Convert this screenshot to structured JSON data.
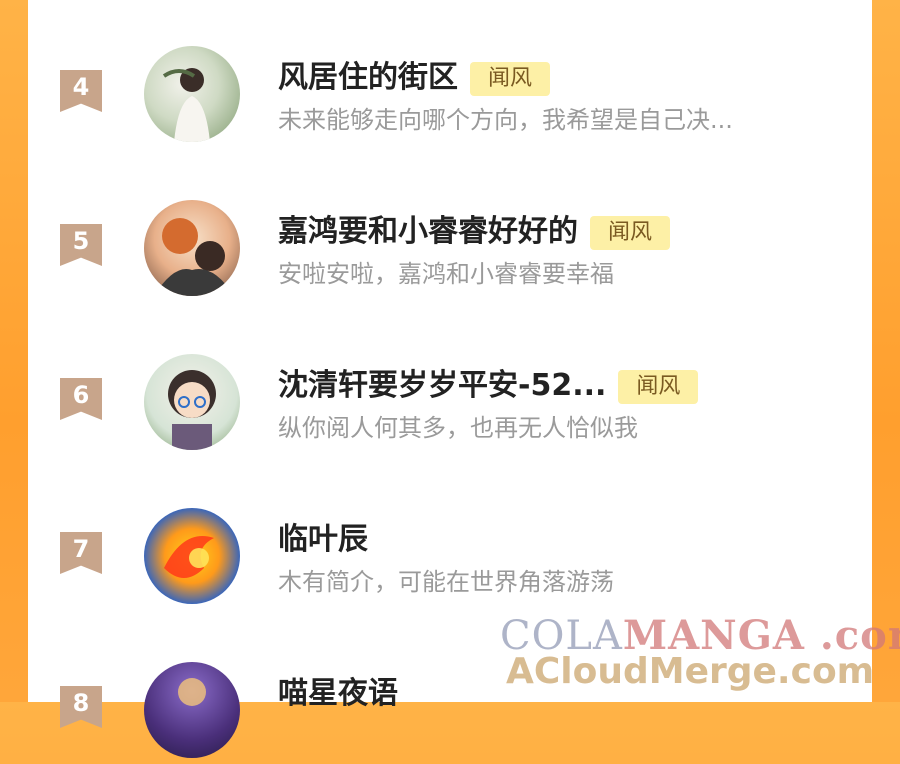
{
  "list": [
    {
      "rank": "4",
      "name": "风居住的街区",
      "tag": "闻风",
      "desc": "未来能够走向哪个方向，我希望是自己决...",
      "avatar_icon": "avatar-girl-garden"
    },
    {
      "rank": "5",
      "name": "嘉鸿要和小睿睿好好的",
      "tag": "闻风",
      "desc": "安啦安啦，嘉鸿和小睿睿要幸福",
      "avatar_icon": "avatar-two-boys-anime"
    },
    {
      "rank": "6",
      "name": "沈清轩要岁岁平安-52...",
      "tag": "闻风",
      "desc": "纵你阅人何其多，也再无人恰似我",
      "avatar_icon": "avatar-chibi-boy-glasses"
    },
    {
      "rank": "7",
      "name": "临叶辰",
      "tag": "",
      "desc": "木有简介，可能在世界角落游荡",
      "avatar_icon": "avatar-flame-swirl"
    },
    {
      "rank": "8",
      "name": "喵星夜语",
      "tag": "",
      "desc": "",
      "avatar_icon": "avatar-night-cat"
    }
  ],
  "watermark": {
    "line1_a": "COLA",
    "line1_b": "MANGA",
    "line1_c": " .com",
    "line2": "ACloudMerge.com"
  },
  "colors": {
    "accent_orange": "#ff9f2e",
    "tag_bg": "#fdf0a6",
    "rank_bg": "#c8a58b"
  }
}
